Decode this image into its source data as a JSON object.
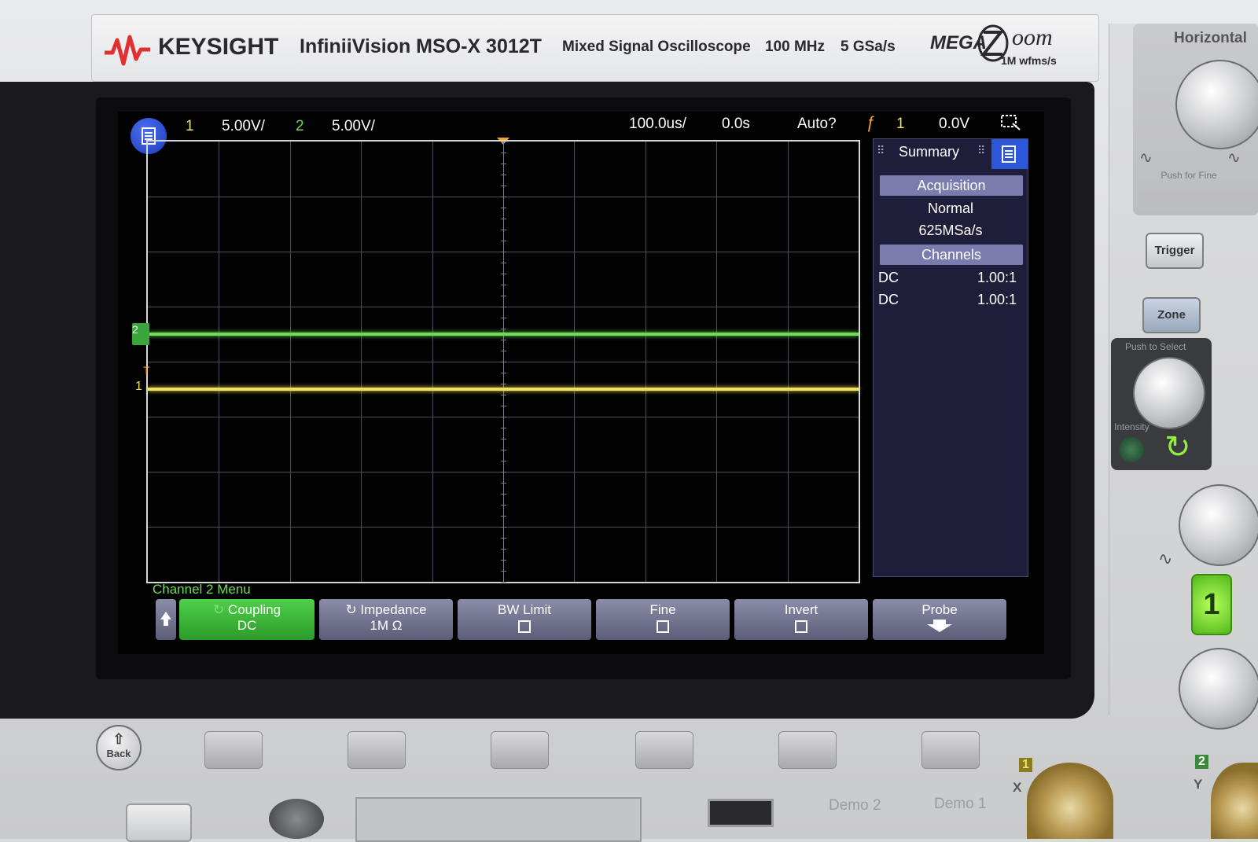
{
  "brand": {
    "logo": "KEYSIGHT",
    "model": "InfiniiVision MSO-X 3012T",
    "subtitle": "Mixed Signal Oscilloscope",
    "bandwidth": "100 MHz",
    "samplerate": "5 GSa/s",
    "megazoom_a": "MEGA",
    "megazoom_b": "oom",
    "megazoom_sub": "1M wfms/s"
  },
  "status": {
    "ch1_num": "1",
    "ch1_scale": "5.00V/",
    "ch2_num": "2",
    "ch2_scale": "5.00V/",
    "timebase": "100.0us/",
    "delay": "0.0s",
    "trigger_mode": "Auto?",
    "trigger_source": "1",
    "trigger_level": "0.0V"
  },
  "traces": {
    "ch1_level_div": -0.5,
    "ch2_level_div": 0.5,
    "ch1_marker": "1",
    "ch2_marker": "2",
    "trigger_marker": "T"
  },
  "summary": {
    "title": "Summary",
    "acq_header": "Acquisition",
    "acq_mode": "Normal",
    "acq_rate": "625MSa/s",
    "ch_header": "Channels",
    "ch1_coupling": "DC",
    "ch1_probe": "1.00:1",
    "ch2_coupling": "DC",
    "ch2_probe": "1.00:1"
  },
  "softkeys": {
    "menu_title": "Channel 2 Menu",
    "coupling_label": "Coupling",
    "coupling_value": "DC",
    "impedance_label": "Impedance",
    "impedance_value": "1M Ω",
    "bwlimit_label": "BW Limit",
    "fine_label": "Fine",
    "invert_label": "Invert",
    "probe_label": "Probe"
  },
  "panel": {
    "horizontal": "Horizontal",
    "push_for_fine": "Push for Fine",
    "trigger_btn": "Trigger",
    "zone_btn": "Zone",
    "push_to_select": "Push to Select",
    "intensity": "Intensity",
    "ch1_button": "1",
    "back": "Back",
    "demo2": "Demo 2",
    "demo1": "Demo 1",
    "x_label": "X",
    "y_label": "Y",
    "input1": "1",
    "input2": "2"
  },
  "colors": {
    "ch1": "#f1e05a",
    "ch2": "#6fdc55",
    "trigger": "#f5a623"
  }
}
